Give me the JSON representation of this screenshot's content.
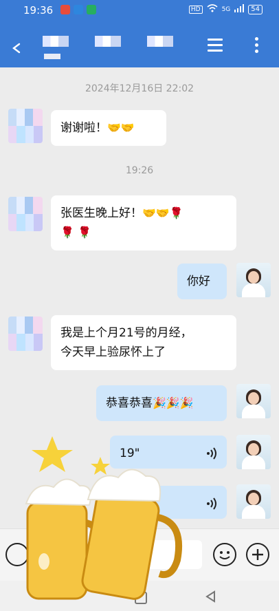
{
  "status_bar": {
    "time": "19:36",
    "network": "5G",
    "battery": "54"
  },
  "chat": {
    "timestamps": [
      "2024年12月16日 22:02",
      "19:26"
    ],
    "messages": [
      {
        "side": "left",
        "text": "谢谢啦！",
        "emoji": "🤝🤝"
      },
      {
        "side": "left",
        "line1": "张医生晚上好！",
        "emoji1": "🤝🤝🌹",
        "emoji2": "🌹 🌹"
      },
      {
        "side": "right",
        "text": "你好"
      },
      {
        "side": "left",
        "line1": "我是上个月21号的月经，",
        "line2": "今天早上验尿怀上了"
      },
      {
        "side": "right",
        "text": "恭喜恭喜",
        "emoji": "🎉🎉🎉"
      },
      {
        "side": "right",
        "type": "voice",
        "duration": "19\""
      },
      {
        "side": "right",
        "type": "voice",
        "duration": ""
      }
    ]
  },
  "colors": {
    "header": "#3a7bd5",
    "outgoing_bubble": "#cfe6fb",
    "incoming_bubble": "#ffffff",
    "background": "#ececec"
  }
}
